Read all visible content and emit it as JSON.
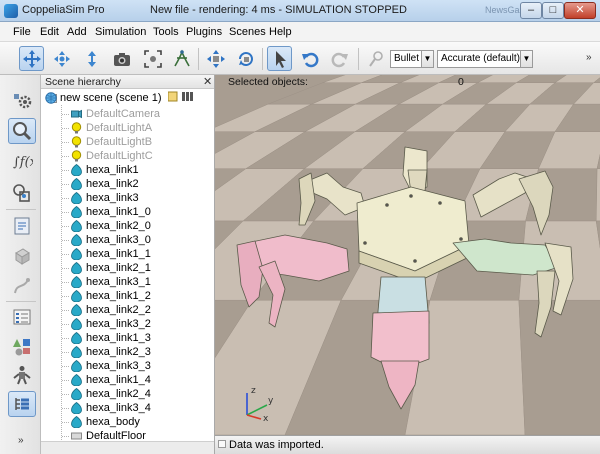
{
  "window": {
    "app_name": "CoppeliaSim Pro",
    "title": "New file - rendering: 4 ms - SIMULATION STOPPED",
    "background_tab_title": "NewsGazette"
  },
  "menu": [
    "File",
    "Edit",
    "Add",
    "Simulation",
    "Tools",
    "Plugins",
    "Scenes",
    "Help"
  ],
  "toolbar": {
    "engine": "Bullet",
    "accuracy": "Accurate (default)",
    "more": "»",
    "icons": [
      "camera-pan-icon",
      "camera-rotate-icon",
      "camera-shift-icon",
      "camera-angle-icon",
      "fit-to-view-icon",
      "manipulation-icon",
      "object-shift-icon",
      "object-rotate-icon",
      "click-select-icon",
      "undo-icon",
      "redo-icon",
      "dynamics-settings-icon"
    ]
  },
  "left_toolbar": {
    "icons": [
      "scene-object-properties-icon",
      "calculation-modules-icon",
      "collections-icon",
      "scripts-icon",
      "shape-edition-icon",
      "path-edition-icon",
      "selection-icon",
      "model-browser-icon",
      "scene-hierarchy-toggle-icon",
      "layers-icon"
    ],
    "more": "»"
  },
  "hierarchy": {
    "title": "Scene hierarchy",
    "close": "✕",
    "root": "new scene (scene 1)",
    "items": [
      {
        "label": "DefaultCamera",
        "dim": true,
        "kind": "camera"
      },
      {
        "label": "DefaultLightA",
        "dim": true,
        "kind": "light"
      },
      {
        "label": "DefaultLightB",
        "dim": true,
        "kind": "light"
      },
      {
        "label": "DefaultLightC",
        "dim": true,
        "kind": "light"
      },
      {
        "label": "hexa_link1",
        "dim": false,
        "kind": "shape"
      },
      {
        "label": "hexa_link2",
        "dim": false,
        "kind": "shape"
      },
      {
        "label": "hexa_link3",
        "dim": false,
        "kind": "shape"
      },
      {
        "label": "hexa_link1_0",
        "dim": false,
        "kind": "shape"
      },
      {
        "label": "hexa_link2_0",
        "dim": false,
        "kind": "shape"
      },
      {
        "label": "hexa_link3_0",
        "dim": false,
        "kind": "shape"
      },
      {
        "label": "hexa_link1_1",
        "dim": false,
        "kind": "shape"
      },
      {
        "label": "hexa_link2_1",
        "dim": false,
        "kind": "shape"
      },
      {
        "label": "hexa_link3_1",
        "dim": false,
        "kind": "shape"
      },
      {
        "label": "hexa_link1_2",
        "dim": false,
        "kind": "shape"
      },
      {
        "label": "hexa_link2_2",
        "dim": false,
        "kind": "shape"
      },
      {
        "label": "hexa_link3_2",
        "dim": false,
        "kind": "shape"
      },
      {
        "label": "hexa_link1_3",
        "dim": false,
        "kind": "shape"
      },
      {
        "label": "hexa_link2_3",
        "dim": false,
        "kind": "shape"
      },
      {
        "label": "hexa_link3_3",
        "dim": false,
        "kind": "shape"
      },
      {
        "label": "hexa_link1_4",
        "dim": false,
        "kind": "shape"
      },
      {
        "label": "hexa_link2_4",
        "dim": false,
        "kind": "shape"
      },
      {
        "label": "hexa_link3_4",
        "dim": false,
        "kind": "shape"
      },
      {
        "label": "hexa_body",
        "dim": false,
        "kind": "shape"
      },
      {
        "label": "DefaultFloor",
        "dim": false,
        "kind": "floor"
      }
    ]
  },
  "viewport": {
    "selected_label": "Selected objects:",
    "selected_count": "0",
    "status": "Data was imported.",
    "axis_labels": [
      "z",
      "y",
      "x"
    ]
  },
  "colors": {
    "accent": "#6e98c8",
    "floor_light": "#c9beb2",
    "floor_dark": "#a89d91",
    "shape_icon": "#29a9c8",
    "light_icon": "#f2e200",
    "robot_body": "#efeccf",
    "robot_pink": "#efb8c7",
    "robot_green": "#cfe6cc"
  }
}
